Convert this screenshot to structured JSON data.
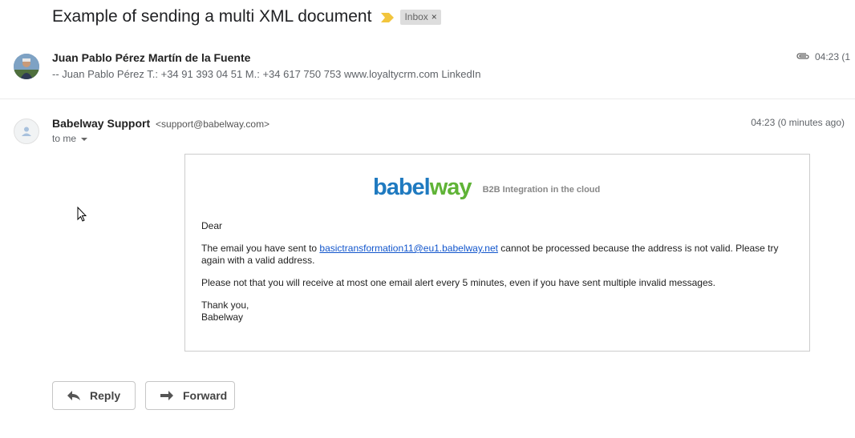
{
  "thread": {
    "subject": "Example of sending a multi XML document",
    "label": "Inbox"
  },
  "message1": {
    "sender": "Juan Pablo Pérez Martín de la Fuente",
    "snippet": "-- Juan Pablo Pérez T.: +34 91 393 04 51 M.: +34 617 750 753 www.loyaltycrm.com LinkedIn",
    "time": "04:23 (1"
  },
  "message2": {
    "sender_name": "Babelway Support",
    "sender_email": "<support@babelway.com>",
    "time": "04:23 (0 minutes ago)",
    "recipient": "to me",
    "logo_part1": "babel",
    "logo_part2": "way",
    "logo_tagline": "B2B Integration in the cloud",
    "greeting": "Dear",
    "para1_prefix": "The email you have sent to ",
    "para1_link": "basictransformation11@eu1.babelway.net",
    "para1_suffix": " cannot be processed because the address is not valid. Please try again with a valid address.",
    "para2": "Please not that you will receive at most one email alert every 5 minutes, even if you have sent multiple invalid messages.",
    "signoff_line1": "Thank you,",
    "signoff_line2": "Babelway"
  },
  "actions": {
    "reply_label": "Reply",
    "forward_label": "Forward"
  },
  "colors": {
    "importance_marker": "#f2c53d",
    "link": "#1155cc",
    "logo_blue": "#1f7ac0",
    "logo_green": "#5fb336"
  }
}
